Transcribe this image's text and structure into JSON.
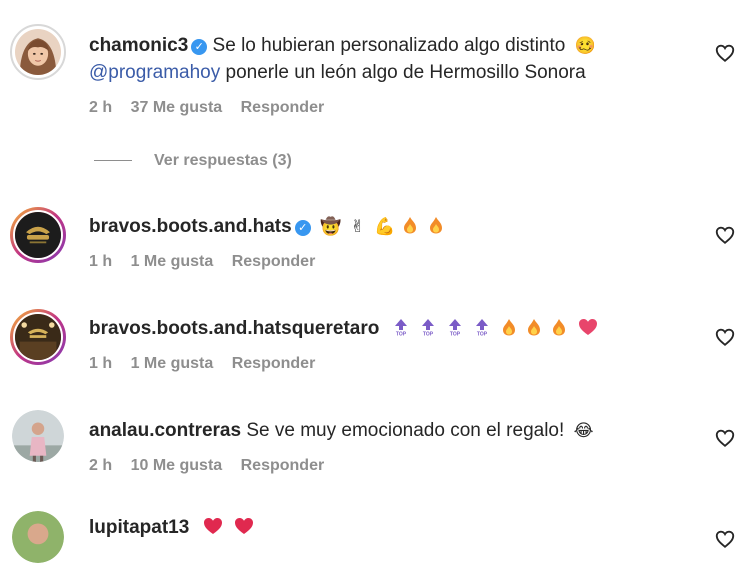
{
  "comments": [
    {
      "user": "chamonic3",
      "verified": true,
      "text_line1": "Se lo hubieran personalizado algo distinto",
      "mention": "@programahoy",
      "text_line2": "ponerle un león algo de Hermosillo Sonora",
      "time": "2 h",
      "likes": "37 Me gusta",
      "reply": "Responder"
    },
    {
      "user": "bravos.boots.and.hats",
      "verified": true,
      "time": "1 h",
      "likes": "1 Me gusta",
      "reply": "Responder"
    },
    {
      "user": "bravos.boots.and.hatsqueretaro",
      "verified": false,
      "time": "1 h",
      "likes": "1 Me gusta",
      "reply": "Responder"
    },
    {
      "user": "analau.contreras",
      "verified": false,
      "text": "Se ve muy emocionado con el regalo!",
      "time": "2 h",
      "likes": "10 Me gusta",
      "reply": "Responder"
    },
    {
      "user": "lupitapat13",
      "verified": false
    }
  ],
  "replies_link": "Ver respuestas (3)",
  "icons": {
    "like": "heart-outline-icon",
    "verified": "verified-badge-icon"
  },
  "colors": {
    "mention": "#3b5ca8",
    "verified": "#3897f0",
    "meta": "#8e8e8e"
  }
}
